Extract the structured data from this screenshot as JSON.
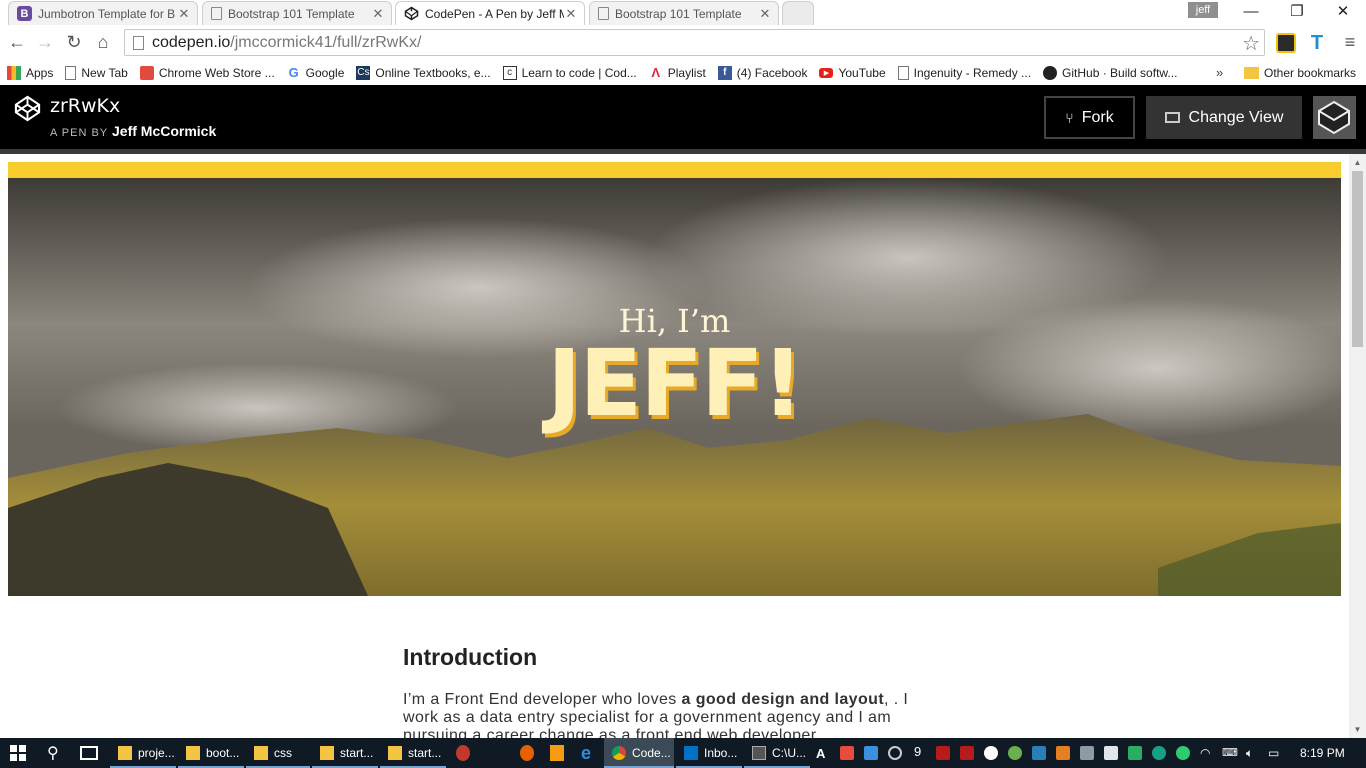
{
  "browser": {
    "tabs": [
      {
        "title": "Jumbotron Template for B",
        "active": false
      },
      {
        "title": "Bootstrap 101 Template",
        "active": false
      },
      {
        "title": "CodePen - A Pen by Jeff M",
        "active": true
      },
      {
        "title": "Bootstrap 101 Template",
        "active": false
      }
    ],
    "profile_name": "jeff",
    "url_host": "codepen.io",
    "url_path": "/jmccormick41/full/zrRwKx/"
  },
  "bookmarks": [
    {
      "label": "Apps",
      "icon": "apps-icon",
      "color": "#e8453c"
    },
    {
      "label": "New Tab",
      "icon": "page-icon",
      "color": "#ffffff"
    },
    {
      "label": "Chrome Web Store ...",
      "icon": "chrome-web-store-icon",
      "color": "#e04a3f"
    },
    {
      "label": "Google",
      "icon": "google-icon",
      "color": "#4285f4"
    },
    {
      "label": "Online Textbooks, e...",
      "icon": "cs-icon",
      "color": "#1b3a5c"
    },
    {
      "label": "Learn to code | Cod...",
      "icon": "codecademy-icon",
      "color": "#333333"
    },
    {
      "label": "Playlist",
      "icon": "playlist-icon",
      "color": "#d9263e"
    },
    {
      "label": "(4) Facebook",
      "icon": "facebook-icon",
      "color": "#3b5998"
    },
    {
      "label": "YouTube",
      "icon": "youtube-icon",
      "color": "#e62117"
    },
    {
      "label": "Ingenuity - Remedy ...",
      "icon": "page-icon",
      "color": "#ffffff"
    },
    {
      "label": "GitHub · Build softw...",
      "icon": "github-icon",
      "color": "#222222"
    }
  ],
  "bookmarks_more": "»",
  "bookmarks_other": "Other bookmarks",
  "codepen": {
    "pen_title": "zrRwKx",
    "byline_prefix": "A PEN BY",
    "author": "Jeff McCormick",
    "fork_label": "Fork",
    "change_view_label": "Change View"
  },
  "page": {
    "hero_greeting": "Hi, I’m",
    "hero_name": "JEFF!",
    "intro_heading": "Introduction",
    "intro_p_before": "I’m a Front End developer who loves ",
    "intro_p_bold": "a good design and layout",
    "intro_p_after": ", . I work as a data entry specialist for a government agency and I am pursuing a career change as a front end web developer."
  },
  "taskbar": {
    "apps": [
      {
        "label": "proje...",
        "icon": "folder-icon"
      },
      {
        "label": "boot...",
        "icon": "folder-icon"
      },
      {
        "label": "css",
        "icon": "folder-icon"
      },
      {
        "label": "start...",
        "icon": "folder-icon"
      },
      {
        "label": "start...",
        "icon": "folder-icon"
      },
      {
        "label": "Code...",
        "icon": "chrome-icon"
      },
      {
        "label": "Inbo...",
        "icon": "outlook-icon"
      },
      {
        "label": "C:\\U...",
        "icon": "console-icon"
      }
    ],
    "tray_badge": "9",
    "clock": "8:19 PM"
  },
  "colors": {
    "codepen_header": "#000000",
    "accent_yellow": "#f9cc2d",
    "hero_text": "#fff0b8",
    "taskbar": "#101a24"
  }
}
